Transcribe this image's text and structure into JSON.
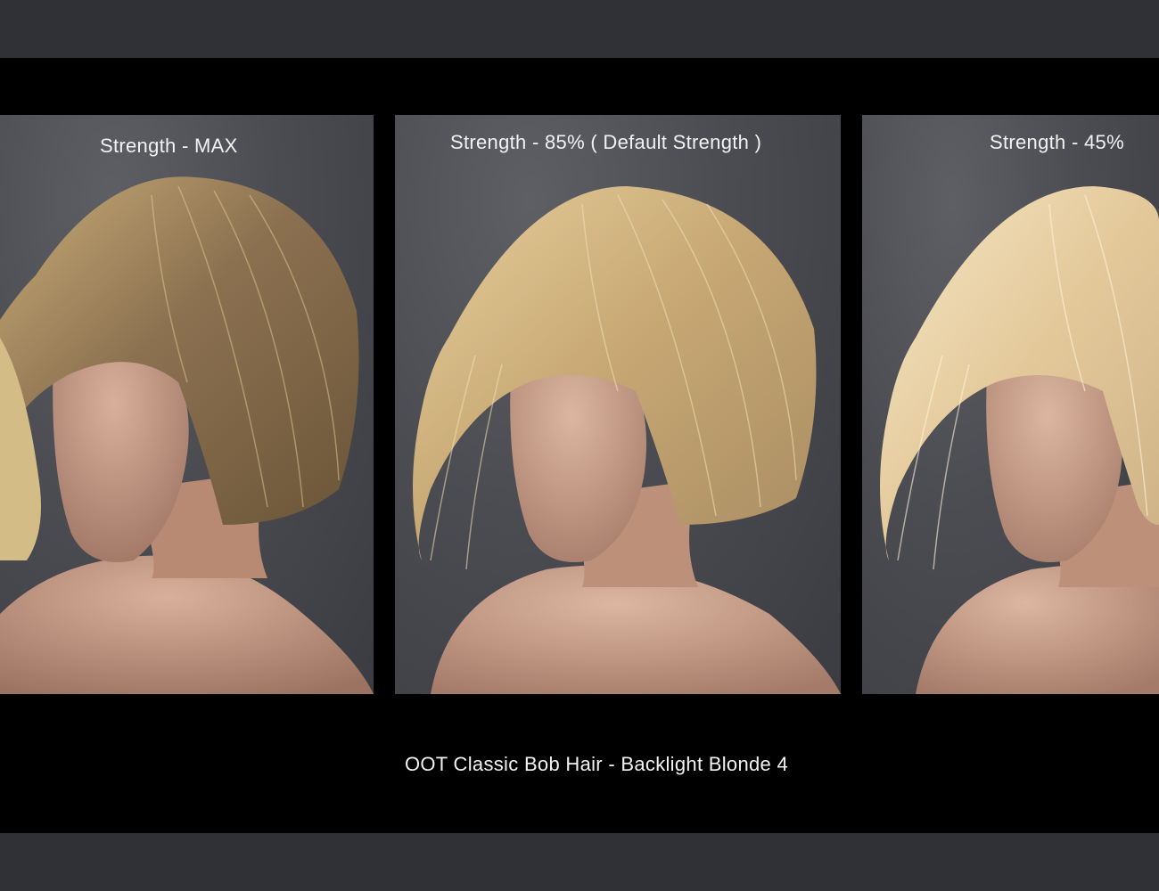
{
  "panels": [
    {
      "caption": "Strength - MAX",
      "hair_tone": "dark",
      "hair_color": "#8c7552",
      "highlight_color": "#d9bf86"
    },
    {
      "caption": "Strength - 85% ( Default Strength )",
      "hair_tone": "medium",
      "hair_color": "#c9a874",
      "highlight_color": "#ead2a0"
    },
    {
      "caption": "Strength - 45%",
      "hair_tone": "light",
      "hair_color": "#e2c898",
      "highlight_color": "#f6e5c2"
    }
  ],
  "footer": {
    "title": "OOT  Classic Bob Hair - Backlight Blonde 4"
  },
  "colors": {
    "background_band": "#303136",
    "stage": "#000000",
    "panel_backdrop": "#4b4c51",
    "skin": "#d2a68c"
  }
}
